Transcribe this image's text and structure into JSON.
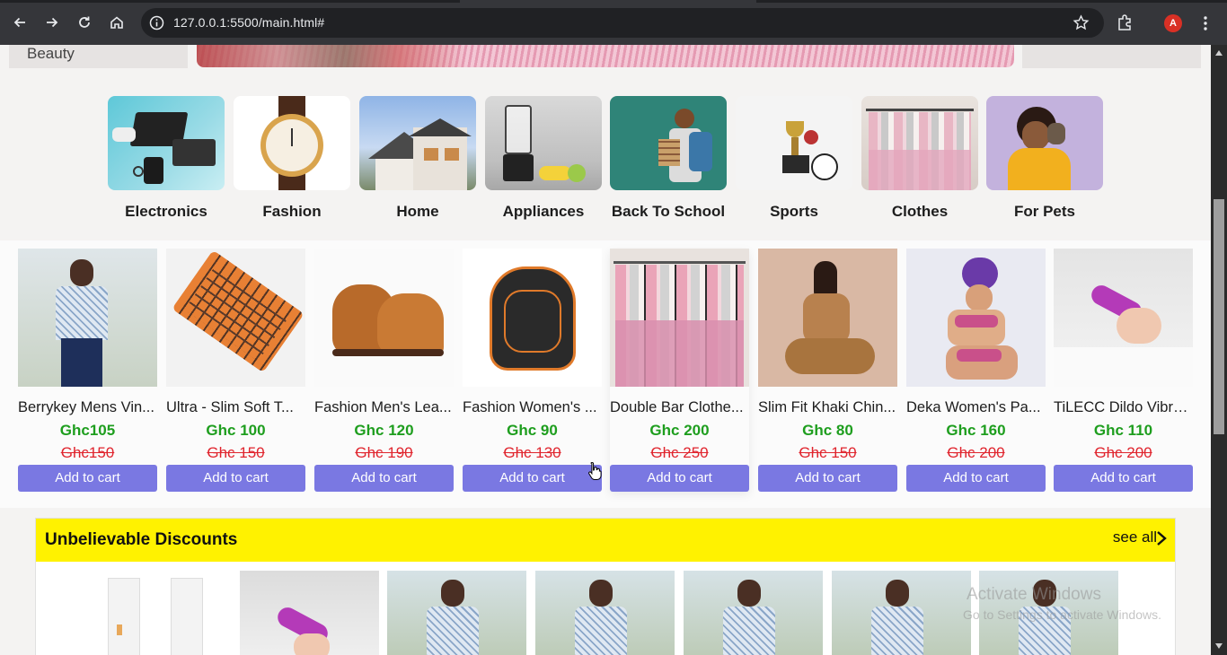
{
  "browser": {
    "url": "127.0.0.1:5500/main.html#",
    "avatar_letter": "A"
  },
  "top_strip": {
    "side_item": "Beauty"
  },
  "categories": [
    {
      "label": "Electronics",
      "icon": "electronics-image"
    },
    {
      "label": "Fashion",
      "icon": "watch-image"
    },
    {
      "label": "Home",
      "icon": "house-image"
    },
    {
      "label": "Appliances",
      "icon": "blender-image"
    },
    {
      "label": "Back To School",
      "icon": "school-image"
    },
    {
      "label": "Sports",
      "icon": "trophy-image"
    },
    {
      "label": "Clothes",
      "icon": "clothes-rack-image"
    },
    {
      "label": "For Pets",
      "icon": "pet-image"
    }
  ],
  "products": [
    {
      "name": "Berrykey Mens Vin...",
      "price": "Ghc105",
      "old_price": "Ghc150",
      "button": "Add to cart"
    },
    {
      "name": "Ultra - Slim Soft T...",
      "price": "Ghc 100",
      "old_price": "Ghc 150",
      "button": "Add to cart"
    },
    {
      "name": "Fashion Men's Lea...",
      "price": "Ghc 120",
      "old_price": "Ghc 190",
      "button": "Add to cart"
    },
    {
      "name": "Fashion Women's ...",
      "price": "Ghc 90",
      "old_price": "Ghc 130",
      "button": "Add to cart"
    },
    {
      "name": "Double Bar Clothe...",
      "price": "Ghc 200",
      "old_price": "Ghc 250",
      "button": "Add to cart"
    },
    {
      "name": "Slim Fit Khaki Chin...",
      "price": "Ghc 80",
      "old_price": "Ghc 150",
      "button": "Add to cart"
    },
    {
      "name": "Deka Women's Pa...",
      "price": "Ghc 160",
      "old_price": "Ghc 200",
      "button": "Add to cart"
    },
    {
      "name": "TiLECC Dildo Vibra...",
      "price": "Ghc 110",
      "old_price": "Ghc 200",
      "button": "Add to cart"
    }
  ],
  "discounts": {
    "title": "Unbelievable Discounts",
    "see_all": "see all"
  },
  "watermark": {
    "line1": "Activate Windows",
    "line2": "Go to Settings to activate Windows."
  },
  "colors": {
    "button": "#7a78e2",
    "price": "#1e9e1e",
    "old_price": "#e0242d",
    "discount_bar": "#fff200"
  }
}
